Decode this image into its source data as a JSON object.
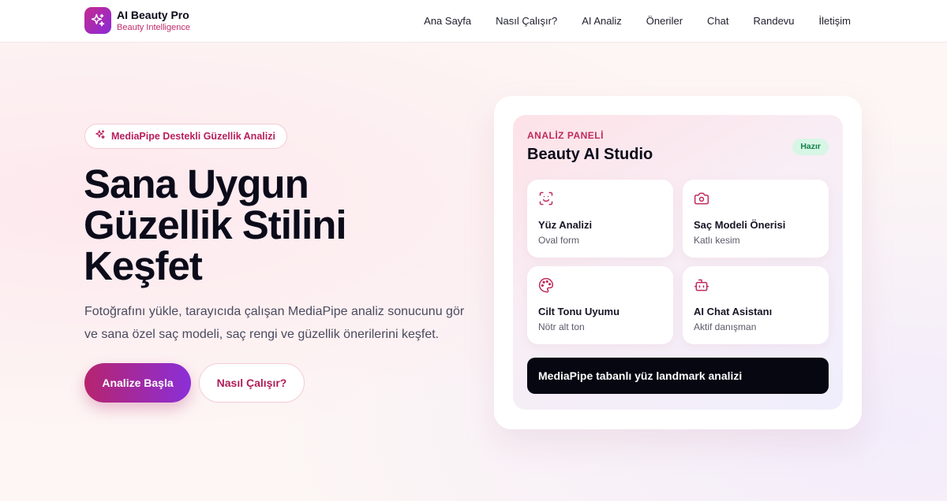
{
  "brand": {
    "name": "AI Beauty Pro",
    "subtitle": "Beauty Intelligence",
    "logo_icon": "sparkles-icon"
  },
  "nav": {
    "items": [
      "Ana Sayfa",
      "Nasıl Çalışır?",
      "AI Analiz",
      "Öneriler",
      "Chat",
      "Randevu",
      "İletişim"
    ]
  },
  "hero": {
    "badge": "MediaPipe Destekli Güzellik Analizi",
    "title_lines": [
      "Sana Uygun",
      "Güzellik Stilini",
      "Keşfet"
    ],
    "description": "Fotoğrafını yükle, tarayıcıda çalışan MediaPipe analiz sonucunu gör ve sana özel saç modeli, saç rengi ve güzellik önerilerini keşfet.",
    "primary_button": "Analize Başla",
    "secondary_button": "Nasıl Çalışır?"
  },
  "panel": {
    "label": "ANALİZ PANELİ",
    "title": "Beauty AI Studio",
    "status": "Hazır",
    "features": [
      {
        "title": "Yüz Analizi",
        "subtitle": "Oval form",
        "icon": "face-scan-icon"
      },
      {
        "title": "Saç Modeli Önerisi",
        "subtitle": "Katlı kesim",
        "icon": "camera-icon"
      },
      {
        "title": "Cilt Tonu Uyumu",
        "subtitle": "Nötr alt ton",
        "icon": "palette-icon"
      },
      {
        "title": "AI Chat Asistanı",
        "subtitle": "Aktif danışman",
        "icon": "robot-icon"
      }
    ],
    "cta": "MediaPipe tabanlı yüz landmark analizi"
  },
  "colors": {
    "accent": "#c02a5e",
    "gradient_start": "#b6246e",
    "gradient_end": "#8b2fd8",
    "dark": "#070712",
    "status_bg": "#d7f6e5"
  }
}
